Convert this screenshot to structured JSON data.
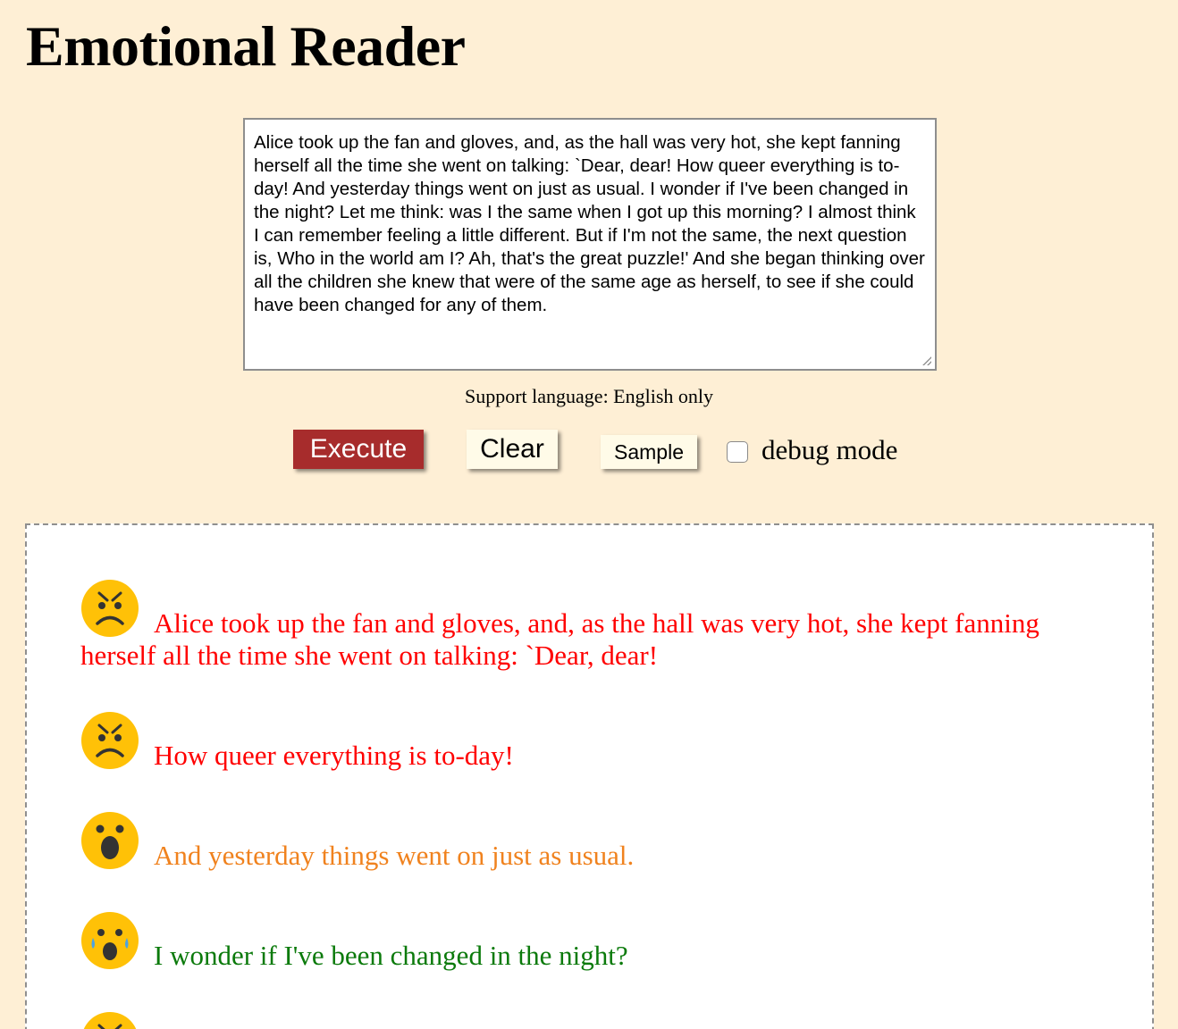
{
  "app": {
    "title": "Emotional Reader"
  },
  "input": {
    "text": "Alice took up the fan and gloves, and, as the hall was very hot, she kept fanning herself all the time she went on talking: `Dear, dear! How queer everything is to-day! And yesterday things went on just as usual. I wonder if I've been changed in the night? Let me think: was I the same when I got up this morning? I almost think I can remember feeling a little different. But if I'm not the same, the next question is, Who in the world am I? Ah, that's the great puzzle!' And she began thinking over all the children she knew that were of the same age as herself, to see if she could have been changed for any of them."
  },
  "support_note": "Support language: English only",
  "toolbar": {
    "execute_label": "Execute",
    "clear_label": "Clear",
    "sample_label": "Sample",
    "debug_label": "debug mode",
    "debug_checked": false
  },
  "colors": {
    "page_bg": "#feefd5",
    "execute_bg": "#a72c2c",
    "anger": "#ff0000",
    "surprise": "#f0821e",
    "sadness": "#0b7a0b",
    "emoji_face": "#ffc107",
    "emoji_features": "#333333"
  },
  "results": [
    {
      "emotion_icon": "angry-face-icon",
      "text": "Alice took up the fan and gloves, and, as the hall was very hot, she kept fanning herself all the time she went on talking: `Dear, dear!",
      "color": "#ff0000"
    },
    {
      "emotion_icon": "angry-face-icon",
      "text": "How queer everything is to-day!",
      "color": "#ff0000"
    },
    {
      "emotion_icon": "astonished-face-icon",
      "text": "And yesterday things went on just as usual.",
      "color": "#f0821e"
    },
    {
      "emotion_icon": "crying-face-icon",
      "text": "I wonder if I've been changed in the night?",
      "color": "#0b7a0b"
    },
    {
      "emotion_icon": "angry-face-icon",
      "text": "",
      "color": "#ff0000"
    }
  ]
}
